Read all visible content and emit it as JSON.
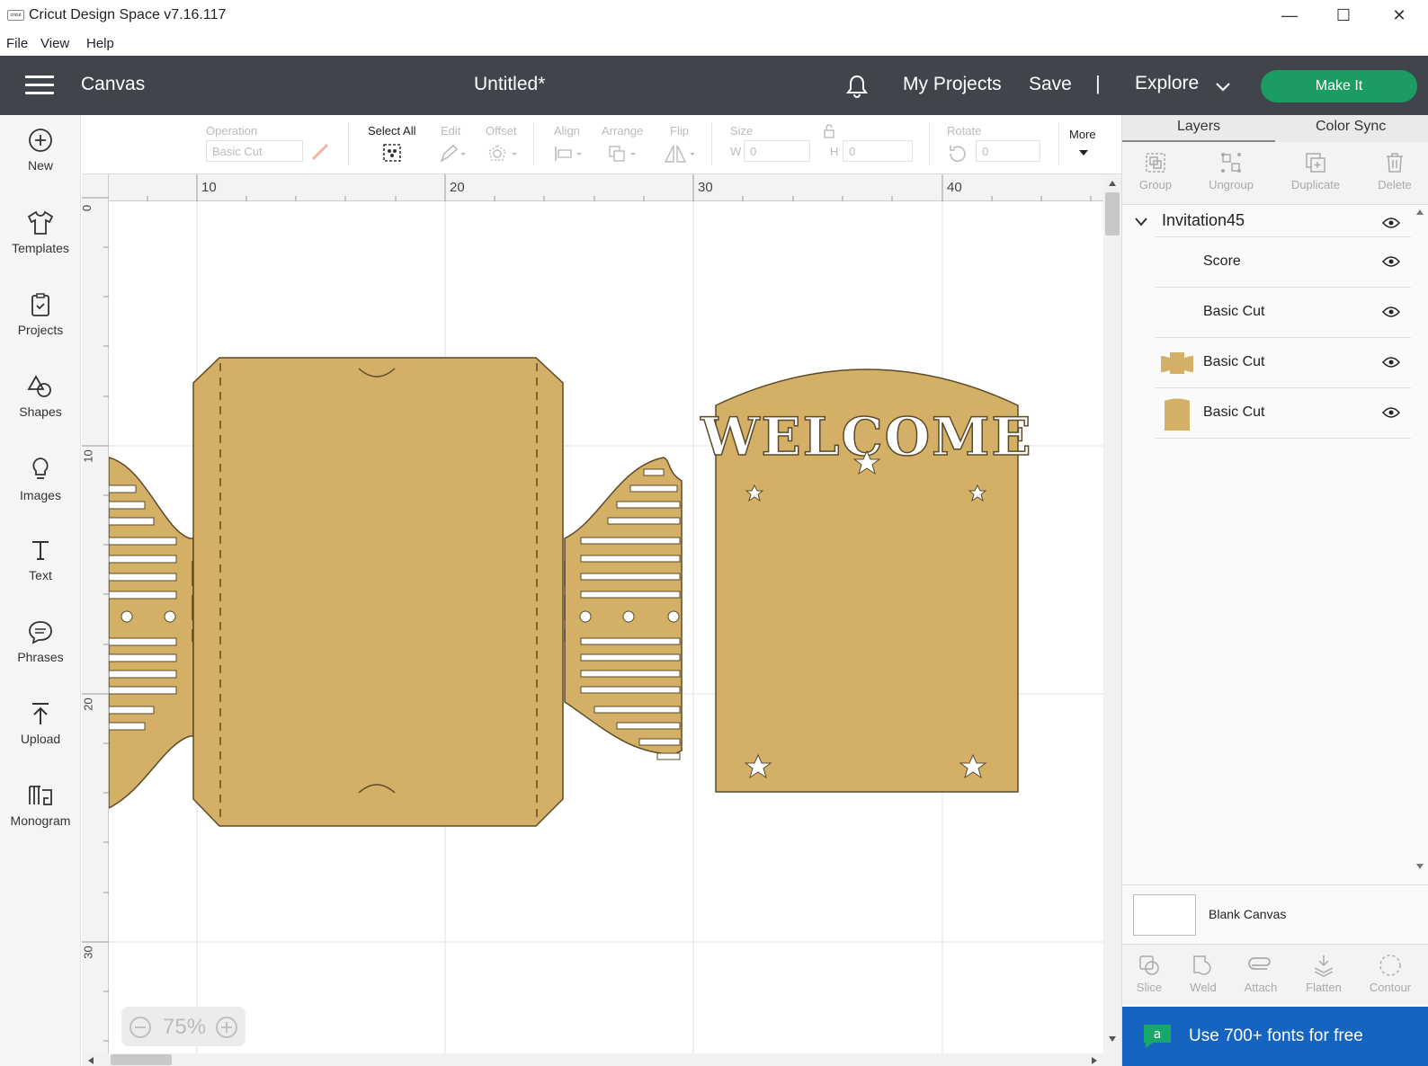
{
  "window": {
    "logo_text": "cricut",
    "title": "Cricut Design Space  v7.16.117",
    "minimize": "—",
    "maximize": "☐",
    "close": "✕"
  },
  "menu": [
    "File",
    "View",
    "Help"
  ],
  "header": {
    "section": "Canvas",
    "doc_title": "Untitled*",
    "my_projects": "My Projects",
    "save": "Save",
    "separator": "|",
    "explore": "Explore",
    "make_it": "Make It"
  },
  "left_nav": [
    {
      "label": "New",
      "icon": "plus-circle-icon"
    },
    {
      "label": "Templates",
      "icon": "tshirt-icon"
    },
    {
      "label": "Projects",
      "icon": "clipboard-icon"
    },
    {
      "label": "Shapes",
      "icon": "shapes-icon"
    },
    {
      "label": "Images",
      "icon": "lightbulb-icon"
    },
    {
      "label": "Text",
      "icon": "text-icon"
    },
    {
      "label": "Phrases",
      "icon": "speech-bubble-icon"
    },
    {
      "label": "Upload",
      "icon": "upload-icon"
    },
    {
      "label": "Monogram",
      "icon": "monogram-icon"
    }
  ],
  "toolbar": {
    "operation_label": "Operation",
    "operation_value": "Basic Cut",
    "select_all": "Select All",
    "edit": "Edit",
    "offset": "Offset",
    "align": "Align",
    "arrange": "Arrange",
    "flip": "Flip",
    "size": "Size",
    "w_label": "W",
    "w_value": "0",
    "h_label": "H",
    "h_value": "0",
    "rotate": "Rotate",
    "rotate_value": "0",
    "more": "More"
  },
  "ruler": {
    "top": [
      "10",
      "20",
      "30",
      "40"
    ],
    "left": [
      "0",
      "10",
      "20",
      "30"
    ]
  },
  "zoom": {
    "value": "75%"
  },
  "canvas_text": {
    "welcome": "WELCOME"
  },
  "colors": {
    "material": "#d4b067",
    "outline": "#5c4a2a",
    "make_it": "#1b9c63",
    "header": "#40454c",
    "promo": "#1565c0"
  },
  "panel": {
    "tabs": [
      "Layers",
      "Color Sync"
    ],
    "tools": [
      "Group",
      "Ungroup",
      "Duplicate",
      "Delete"
    ],
    "group_name": "Invitation45",
    "layers": [
      "Score",
      "Basic Cut",
      "Basic Cut",
      "Basic Cut"
    ],
    "blank_canvas": "Blank Canvas",
    "bottom_tools": [
      "Slice",
      "Weld",
      "Attach",
      "Flatten",
      "Contour"
    ],
    "promo": "Use 700+ fonts for free",
    "promo_badge": "a"
  }
}
